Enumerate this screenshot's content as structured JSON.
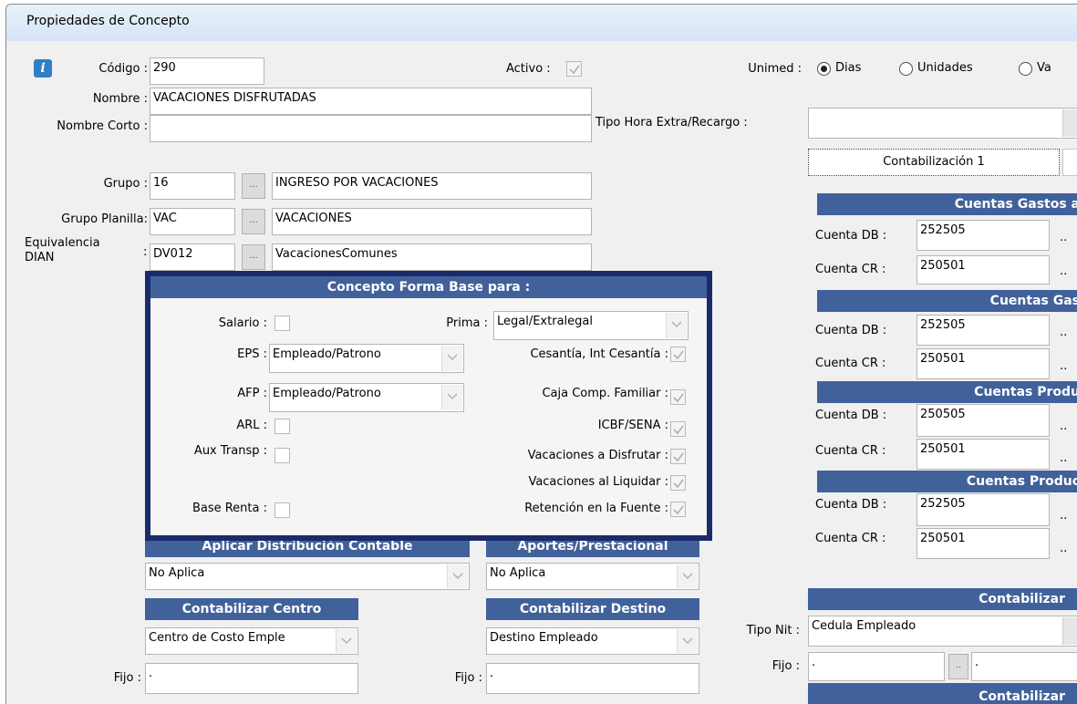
{
  "window": {
    "title": "Propiedades de Concepto"
  },
  "left": {
    "codigo": {
      "label": "Código :",
      "value": "290"
    },
    "activo": {
      "label": "Activo :",
      "checked": true
    },
    "nombre": {
      "label": "Nombre :",
      "value": "VACACIONES DISFRUTADAS"
    },
    "nombre_corto": {
      "label": "Nombre Corto :",
      "value": ""
    },
    "grupo": {
      "label": "Grupo :",
      "code": "16",
      "desc": "INGRESO POR VACACIONES",
      "dots": "..."
    },
    "grupo_planilla": {
      "label": "Grupo Planilla:",
      "code": "VAC",
      "desc": "VACACIONES",
      "dots": "..."
    },
    "equivalencia": {
      "label_1": "Equivalencia",
      "label_colon": ":",
      "label_2": "DIAN",
      "code": "DV012",
      "desc": "VacacionesComunes",
      "dots": "..."
    }
  },
  "base_panel": {
    "title": "Concepto Forma Base para :",
    "salario": {
      "label": "Salario :",
      "checked": false
    },
    "prima": {
      "label": "Prima :",
      "value": "Legal/Extralegal"
    },
    "eps": {
      "label": "EPS :",
      "value": "Empleado/Patrono"
    },
    "cesantia": {
      "label": "Cesantía, Int Cesantía :",
      "checked": true
    },
    "afp": {
      "label": "AFP :",
      "value": "Empleado/Patrono"
    },
    "caja": {
      "label": "Caja Comp. Familiar :",
      "checked": true
    },
    "arl": {
      "label": "ARL :",
      "checked": false
    },
    "icbf": {
      "label": "ICBF/SENA :",
      "checked": true
    },
    "aux": {
      "label": "Aux Transp :",
      "checked": false
    },
    "vac_disfrutar": {
      "label": "Vacaciones a Disfrutar :",
      "checked": true
    },
    "vac_liquidar": {
      "label": "Vacaciones al Liquidar :",
      "checked": true
    },
    "base_renta": {
      "label": "Base Renta :",
      "checked": false
    },
    "retencion": {
      "label": "Retención en la Fuente :",
      "checked": true
    }
  },
  "dist": {
    "aplicar_header": "Aplicar Distribución Contable",
    "aplicar_value": "No Aplica",
    "aportes_header": "Aportes/Prestacional",
    "aportes_value": "No Aplica",
    "centro_header": "Contabilizar Centro",
    "centro_value": "Centro de Costo Emple",
    "destino_header": "Contabilizar Destino",
    "destino_value": "Destino Empleado",
    "fijo_label": "Fijo :",
    "fijo_left_value": ".",
    "fijo_mid_value": "."
  },
  "right": {
    "unimed_label": "Unimed :",
    "radio_dias": "Dias",
    "radio_unidades": "Unidades",
    "radio_valor": "Va",
    "tipo_hora_label": "Tipo Hora Extra/Recargo :",
    "tipo_hora_value": "",
    "tab_contab1": "Contabilización 1",
    "sections": [
      {
        "header": "Cuentas Gastos a",
        "db_label": "Cuenta DB :",
        "db": "252505",
        "cr_label": "Cuenta CR :",
        "cr": "250501",
        "dots": ".."
      },
      {
        "header": "Cuentas Gas",
        "db_label": "Cuenta DB :",
        "db": "252505",
        "cr_label": "Cuenta CR :",
        "cr": "250501",
        "dots": ".."
      },
      {
        "header": "Cuentas Produ",
        "db_label": "Cuenta DB :",
        "db": "250505",
        "cr_label": "Cuenta CR :",
        "cr": "250501",
        "dots": ".."
      },
      {
        "header": "Cuentas Produc",
        "db_label": "Cuenta DB :",
        "db": "252505",
        "cr_label": "Cuenta CR :",
        "cr": "250501",
        "dots": ".."
      }
    ],
    "contabilizar_header": "Contabilizar",
    "tipo_nit_label": "Tipo Nit :",
    "tipo_nit_value": "Cedula Empleado",
    "fijo_label": "Fijo :",
    "fijo_value": ".",
    "fijo_value2": ".",
    "contabilizar_header2": "Contabilizar"
  },
  "colors": {
    "header_blue": "#41619b",
    "overlay_border": "#1a2a6b",
    "info_icon": "#2f7fc6"
  }
}
